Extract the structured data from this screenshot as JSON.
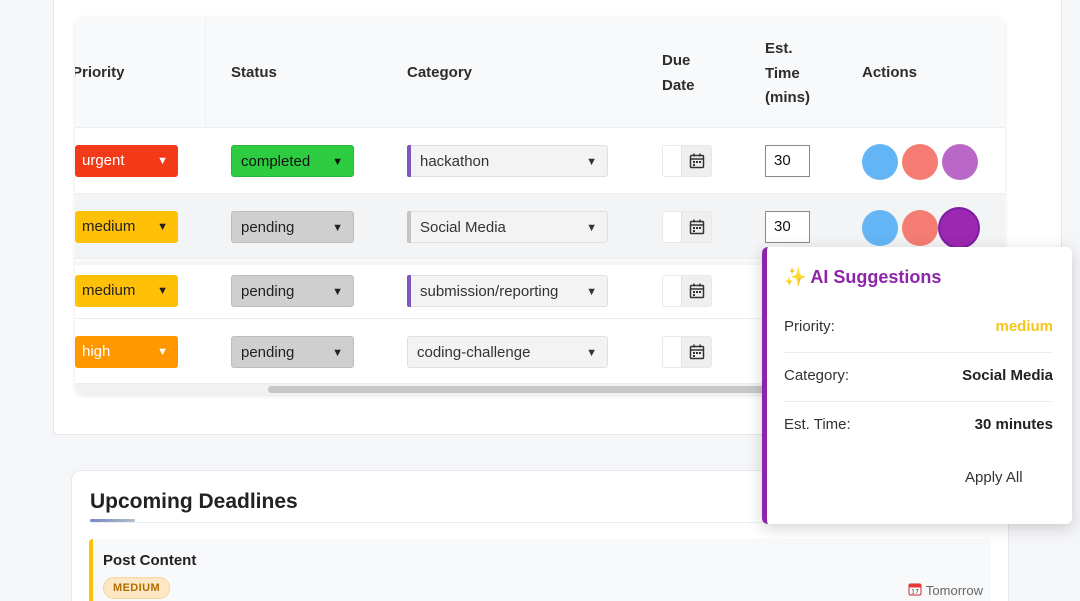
{
  "table": {
    "headers": {
      "priority": "Priority",
      "status": "Status",
      "category": "Category",
      "due_date": "Due Date",
      "est_time": "Est. Time (mins)",
      "actions": "Actions"
    },
    "rows": [
      {
        "priority": "urgent",
        "status": "completed",
        "category": "hackathon",
        "est": "30"
      },
      {
        "priority": "medium",
        "status": "pending",
        "category": "Social Media",
        "est": "30"
      },
      {
        "priority": "medium",
        "status": "pending",
        "category": "submission/reporting",
        "est": ""
      },
      {
        "priority": "high",
        "status": "pending",
        "category": "coding-challenge",
        "est": ""
      }
    ]
  },
  "deadlines": {
    "title": "Upcoming Deadlines",
    "items": [
      {
        "title": "Post Content",
        "badge": "MEDIUM",
        "date": "Tomorrow"
      }
    ]
  },
  "ai": {
    "icon": "✨",
    "title": "AI Suggestions",
    "priority_label": "Priority:",
    "priority_value": "medium",
    "category_label": "Category:",
    "category_value": "Social Media",
    "time_label": "Est. Time:",
    "time_value": "30 minutes",
    "apply_label": "Apply All"
  },
  "icons": {
    "calendar": "calendar-icon",
    "sparkles": "sparkles-icon",
    "caret": "caret-down-icon"
  },
  "colors": {
    "urgent": "#f23a18",
    "medium": "#ffc107",
    "high": "#ff9800",
    "completed": "#2ecc40",
    "pending": "#cfcfcf",
    "action_blue": "#64b5f6",
    "action_red": "#f47c72",
    "action_purple": "#ba68c8",
    "ai_accent": "#8e24aa"
  }
}
